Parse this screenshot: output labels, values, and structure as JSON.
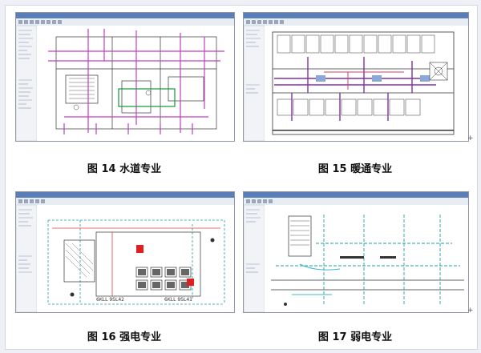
{
  "figures": [
    {
      "id": "fig14",
      "caption": "图 14 水道专业",
      "marks": []
    },
    {
      "id": "fig15",
      "caption": "图 15 暖通专业",
      "marks": []
    },
    {
      "id": "fig16",
      "caption": "图 16 强电专业",
      "marks": [
        "6KLL 9SL42",
        "6KLL 9SL41"
      ]
    },
    {
      "id": "fig17",
      "caption": "图 17 弱电专业",
      "marks": []
    }
  ],
  "colors": {
    "sheet_bg": "#ffffff",
    "page_bg": "#eef0f6",
    "titlebar": "#5a7fb8",
    "plumbing": "#c040c0",
    "hvac": "#8030a0",
    "power": "#e04040",
    "lowvoltage": "#20a0a0"
  }
}
